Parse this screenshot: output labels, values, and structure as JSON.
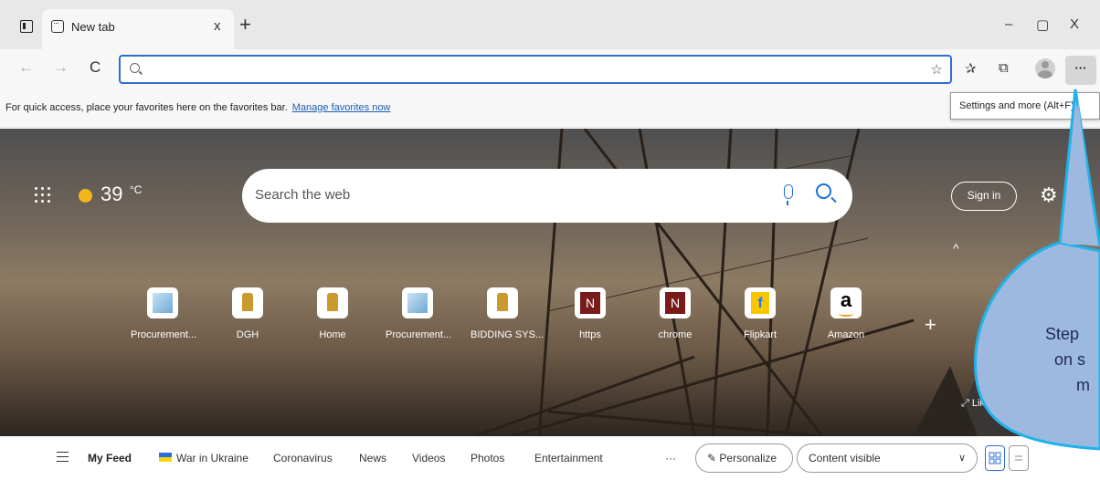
{
  "tab": {
    "title": "New tab",
    "close": "x",
    "new_tab": "+"
  },
  "window": {
    "minimize": "–",
    "restore": "▢",
    "close": "X"
  },
  "nav": {
    "back": "←",
    "forward": "→",
    "reload": "C"
  },
  "address_bar": {
    "value": "",
    "add_favorite_icon": "☆"
  },
  "toolbar": {
    "favorites_icon": "✰",
    "collections_icon": "⧉",
    "more_label": "···"
  },
  "favorites_bar": {
    "message": "For quick access, place your favorites here on the favorites bar.",
    "link": "Manage favorites now"
  },
  "tooltip": {
    "text": "Settings and more (Alt+F)"
  },
  "weather": {
    "temperature": "39",
    "unit": "°C"
  },
  "search": {
    "placeholder": "Search the web"
  },
  "signin": {
    "label": "Sign in"
  },
  "icons": {
    "settings": "⚙",
    "chevron_up": "^",
    "add_site": "+",
    "expand": "⤢"
  },
  "quick_links": [
    {
      "label": "Procurement...",
      "icon": "procurement-icon"
    },
    {
      "label": "DGH",
      "icon": "emblem-icon"
    },
    {
      "label": "Home",
      "icon": "emblem-icon"
    },
    {
      "label": "Procurement...",
      "icon": "procurement-icon"
    },
    {
      "label": "BIDDING SYS...",
      "icon": "emblem-icon"
    },
    {
      "label": "https",
      "icon": "n-icon",
      "glyph": "N"
    },
    {
      "label": "chrome",
      "icon": "n-icon",
      "glyph": "N"
    },
    {
      "label": "Flipkart",
      "icon": "flipkart-icon",
      "glyph": "f"
    },
    {
      "label": "Amazon",
      "icon": "amazon-icon",
      "glyph": "a"
    }
  ],
  "background": {
    "like_this": "Like this"
  },
  "callout": {
    "lines": [
      "Step",
      "on s",
      "m"
    ],
    "fill": "#9db9e0",
    "stroke": "#1fb3ea"
  },
  "feed": {
    "my_feed": "My Feed",
    "items": [
      "War in Ukraine",
      "Coronavirus",
      "News",
      "Videos",
      "Photos",
      "Entertainment"
    ],
    "more": "···",
    "personalize": "Personalize",
    "content_visible": "Content visible"
  },
  "colors": {
    "accent": "#2b6fd6",
    "link": "#1a5fb4"
  }
}
